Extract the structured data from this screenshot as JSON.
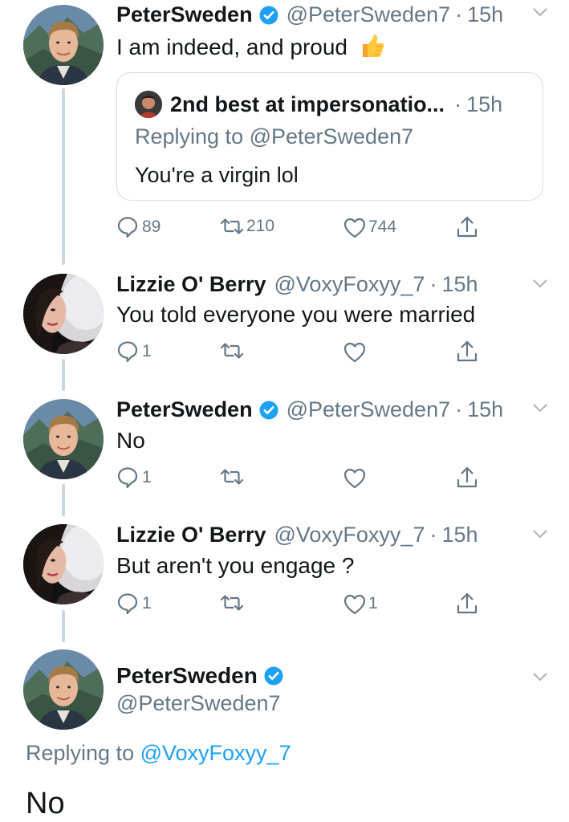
{
  "colors": {
    "text": "#14171a",
    "secondary": "#657786",
    "link": "#1da1f2",
    "verified": "#1da1f2",
    "thread_line": "#ccd6dd"
  },
  "tweets": [
    {
      "name": "PeterSweden",
      "verified": true,
      "handle": "@PeterSweden7",
      "separator": "·",
      "time": "15h",
      "text": "I am indeed, and proud",
      "emoji": "thumbs-up",
      "quote": {
        "name": "2nd best at impersonatio...",
        "separator": "·",
        "time": "15h",
        "replying": "Replying to @PeterSweden7",
        "text": "You're a virgin lol"
      },
      "counts": {
        "replies": "89",
        "retweets": "210",
        "likes": "744"
      }
    },
    {
      "name": "Lizzie O' Berry",
      "verified": false,
      "handle": "@VoxyFoxyy_7",
      "separator": "·",
      "time": "15h",
      "text": "You told everyone you were married",
      "counts": {
        "replies": "1",
        "retweets": "",
        "likes": ""
      }
    },
    {
      "name": "PeterSweden",
      "verified": true,
      "handle": "@PeterSweden7",
      "separator": "·",
      "time": "15h",
      "text": "No",
      "counts": {
        "replies": "1",
        "retweets": "",
        "likes": ""
      }
    },
    {
      "name": "Lizzie O' Berry",
      "verified": false,
      "handle": "@VoxyFoxyy_7",
      "separator": "·",
      "time": "15h",
      "text": "But aren't you engage ?",
      "counts": {
        "replies": "1",
        "retweets": "",
        "likes": "1"
      }
    }
  ],
  "focus": {
    "name": "PeterSweden",
    "verified": true,
    "handle": "@PeterSweden7",
    "replying_prefix": "Replying to ",
    "replying_to": "@VoxyFoxyy_7",
    "text": "No"
  }
}
